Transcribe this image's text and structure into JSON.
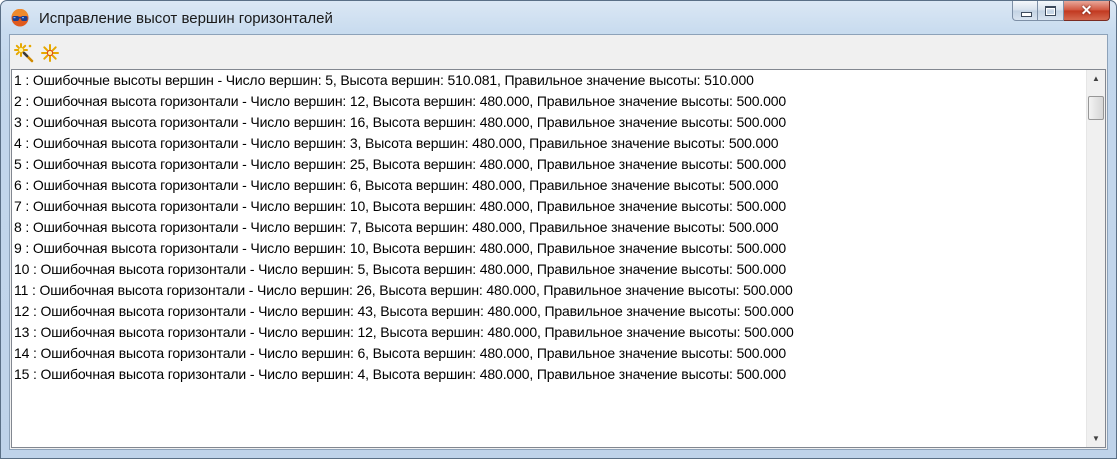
{
  "window": {
    "title": "Исправление высот вершин горизонталей",
    "icon": "glasses-app-icon",
    "buttons": [
      "minimize-icon",
      "maximize-icon",
      "close-icon"
    ],
    "close_glyph": "✕"
  },
  "toolbar": {
    "buttons": [
      {
        "icon": "magic-wand-sparkle-icon"
      },
      {
        "icon": "sparkle-icon"
      }
    ]
  },
  "errors_list": {
    "items": [
      "1  : Ошибочные высоты вершин - Число вершин: 5,  Высота вершин: 510.081,  Правильное значение высоты: 510.000",
      "2  : Ошибочная высота горизонтали - Число вершин: 12,  Высота вершин: 480.000,  Правильное значение высоты: 500.000",
      "3  : Ошибочная высота горизонтали - Число вершин: 16,  Высота вершин: 480.000,  Правильное значение высоты: 500.000",
      "4  : Ошибочная высота горизонтали - Число вершин: 3,  Высота вершин: 480.000,  Правильное значение высоты: 500.000",
      "5  : Ошибочная высота горизонтали - Число вершин: 25,  Высота вершин: 480.000,  Правильное значение высоты: 500.000",
      "6  : Ошибочная высота горизонтали - Число вершин: 6,  Высота вершин: 480.000,  Правильное значение высоты: 500.000",
      "7  : Ошибочная высота горизонтали - Число вершин: 10,  Высота вершин: 480.000,  Правильное значение высоты: 500.000",
      "8  : Ошибочная высота горизонтали - Число вершин: 7,  Высота вершин: 480.000,  Правильное значение высоты: 500.000",
      "9  : Ошибочная высота горизонтали - Число вершин: 10,  Высота вершин: 480.000,  Правильное значение высоты: 500.000",
      "10  : Ошибочная высота горизонтали - Число вершин: 5,  Высота вершин: 480.000,  Правильное значение высоты: 500.000",
      "11  : Ошибочная высота горизонтали - Число вершин: 26,  Высота вершин: 480.000,  Правильное значение высоты: 500.000",
      "12  : Ошибочная высота горизонтали - Число вершин: 43,  Высота вершин: 480.000,  Правильное значение высоты: 500.000",
      "13  : Ошибочная высота горизонтали - Число вершин: 12,  Высота вершин: 480.000,  Правильное значение высоты: 500.000",
      "14  : Ошибочная высота горизонтали - Число вершин: 6,  Высота вершин: 480.000,  Правильное значение высоты: 500.000",
      "15  : Ошибочная высота горизонтали - Число вершин: 4,  Высота вершин: 480.000,  Правильное значение высоты: 500.000"
    ]
  },
  "scrollbar": {
    "up_glyph": "▲",
    "down_glyph": "▼"
  },
  "colors": {
    "title_bar": "#c9dcef",
    "close_button": "#c1371f",
    "list_background": "#ffffff",
    "toolbar_icon": "#e6a800"
  }
}
